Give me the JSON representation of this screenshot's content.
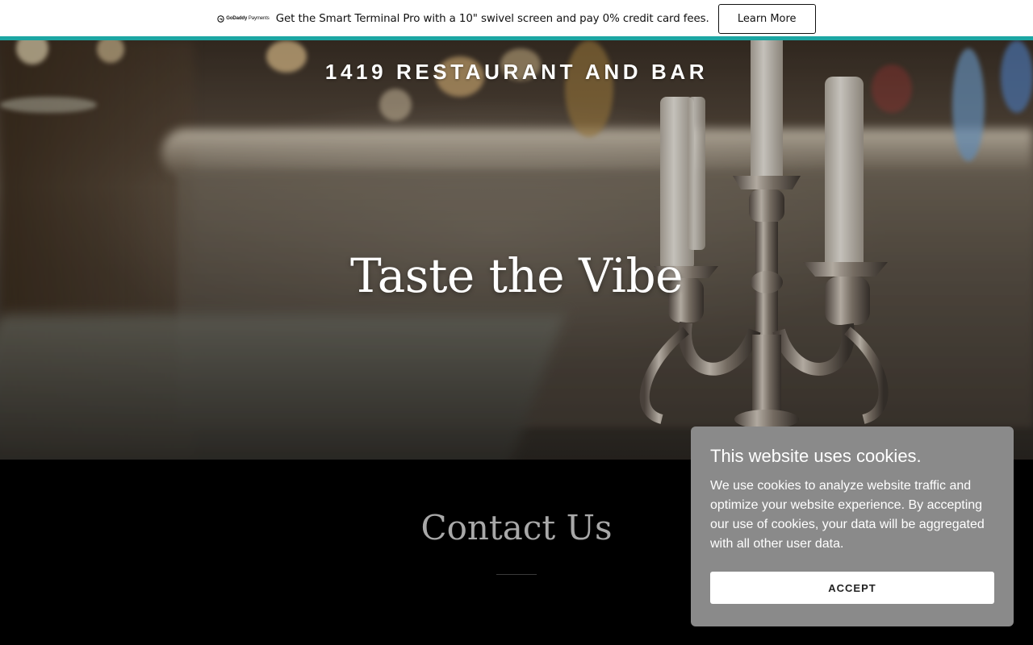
{
  "promo": {
    "logo_brand": "GoDaddy",
    "logo_product": "Payments",
    "message": "Get the Smart Terminal Pro with a 10\" swivel screen and pay 0% credit card fees.",
    "cta_label": "Learn More",
    "accent_color": "#1ca6a3"
  },
  "header": {
    "site_title": "1419 RESTAURANT AND BAR"
  },
  "hero": {
    "heading": "Taste the Vibe"
  },
  "contact": {
    "heading": "Contact Us"
  },
  "cookie_banner": {
    "title": "This website uses cookies.",
    "body": "We use cookies to analyze website traffic and optimize your website experience. By accepting our use of cookies, your data will be aggregated with all other user data.",
    "accept_label": "ACCEPT",
    "background_color": "#8a8a8a"
  }
}
